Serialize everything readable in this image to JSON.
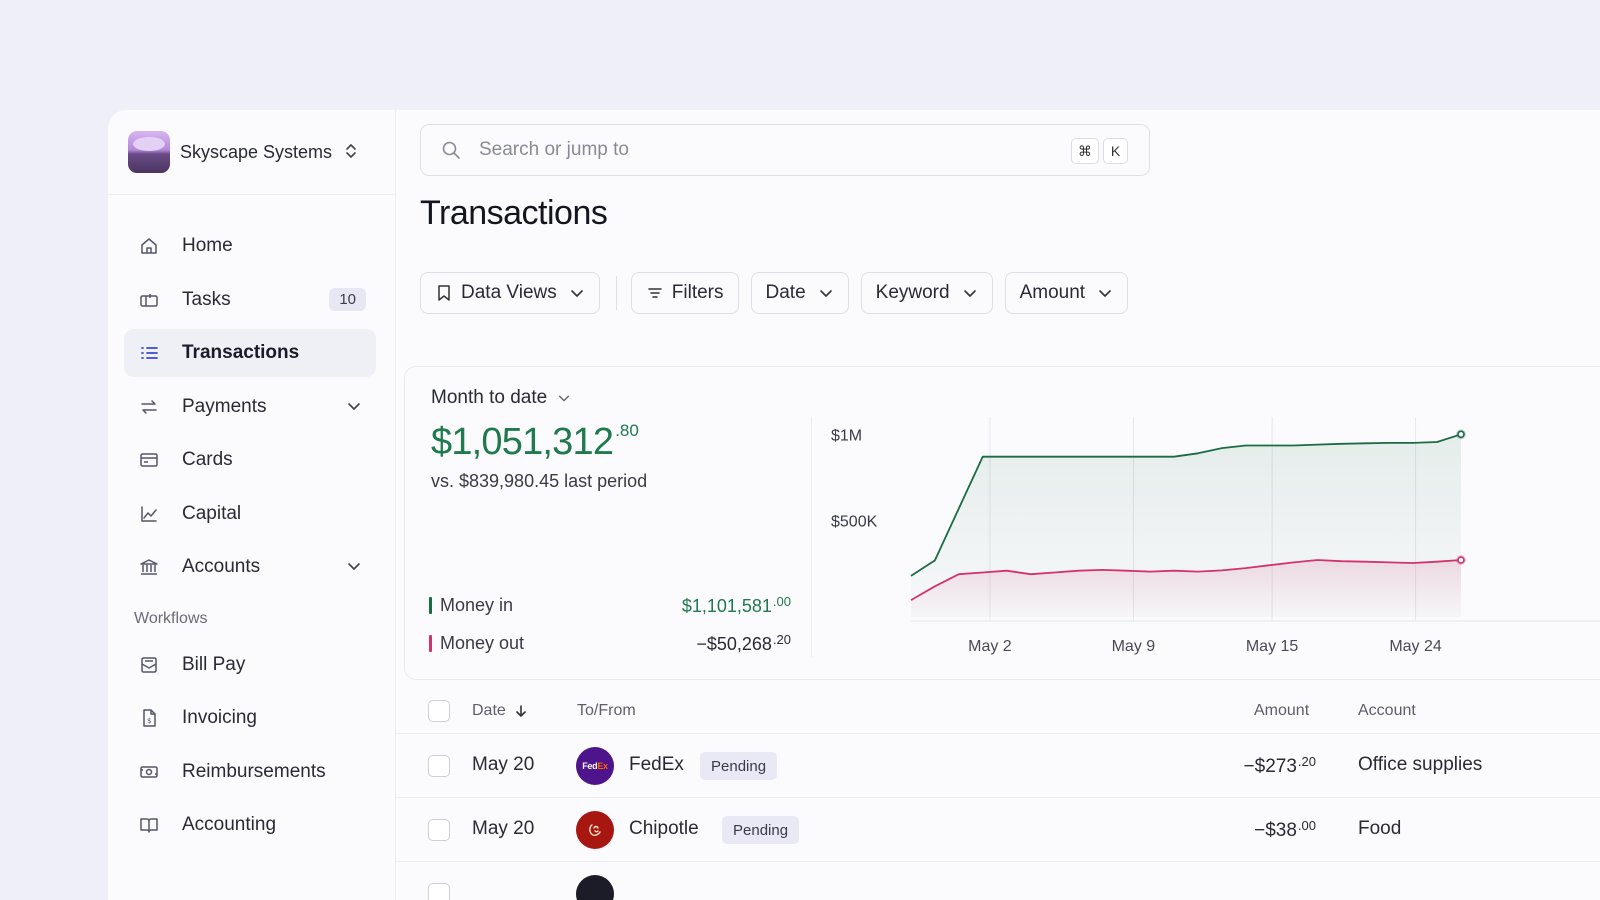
{
  "org": {
    "name": "Skyscape Systems"
  },
  "nav": {
    "items": [
      {
        "label": "Home",
        "icon": "home-icon"
      },
      {
        "label": "Tasks",
        "icon": "tasks-icon",
        "badge": "10"
      },
      {
        "label": "Transactions",
        "icon": "list-icon",
        "active": true
      },
      {
        "label": "Payments",
        "icon": "transfer-icon",
        "expandable": true
      },
      {
        "label": "Cards",
        "icon": "card-icon"
      },
      {
        "label": "Capital",
        "icon": "chart-line-icon"
      },
      {
        "label": "Accounts",
        "icon": "bank-icon",
        "expandable": true
      }
    ],
    "section_label": "Workflows",
    "workflow_items": [
      {
        "label": "Bill Pay",
        "icon": "bill-icon"
      },
      {
        "label": "Invoicing",
        "icon": "invoice-icon"
      },
      {
        "label": "Reimbursements",
        "icon": "reimbursement-icon"
      },
      {
        "label": "Accounting",
        "icon": "book-icon"
      }
    ]
  },
  "search": {
    "placeholder": "Search or jump to",
    "kbd_mod": "⌘",
    "kbd_key": "K"
  },
  "page": {
    "title": "Transactions"
  },
  "filters": {
    "data_views": "Data Views",
    "filters": "Filters",
    "date": "Date",
    "keyword": "Keyword",
    "amount": "Amount"
  },
  "summary": {
    "period": "Month to date",
    "total_main": "$1,051,312",
    "total_cents": ".80",
    "comparison": "vs. $839,980.45 last period",
    "money_in_label": "Money in",
    "money_in_main": "$1,101,581",
    "money_in_cents": ".00",
    "money_out_label": "Money out",
    "money_out_main": "−$50,268",
    "money_out_cents": ".20"
  },
  "colors": {
    "money_in": "#1b6b44",
    "money_out": "#d1336f",
    "accent": "#3e4ad0",
    "green_text": "#1f7a4d"
  },
  "chart_data": {
    "type": "line",
    "x_ticks": [
      "May 2",
      "May 9",
      "May 15",
      "May 24"
    ],
    "y_ticks": [
      "$1M",
      "$500K"
    ],
    "ylim": [
      0,
      1100000
    ],
    "x": [
      0,
      1,
      2,
      3,
      4,
      5,
      6,
      7,
      8,
      9,
      10,
      11,
      12,
      13,
      14,
      15,
      16,
      17,
      18,
      19,
      20,
      21,
      22,
      23
    ],
    "series": [
      {
        "name": "Money in",
        "values": [
          180000,
          270000,
          570000,
          870000,
          870000,
          870000,
          870000,
          870000,
          870000,
          870000,
          870000,
          870000,
          890000,
          920000,
          935000,
          935000,
          935000,
          940000,
          945000,
          948000,
          950000,
          950000,
          955000,
          1000000
        ]
      },
      {
        "name": "Money out",
        "values": [
          40000,
          120000,
          190000,
          200000,
          210000,
          190000,
          200000,
          210000,
          215000,
          210000,
          205000,
          210000,
          205000,
          212000,
          225000,
          242000,
          258000,
          272000,
          265000,
          262000,
          258000,
          255000,
          262000,
          272000
        ]
      }
    ],
    "grid": "vertical"
  },
  "table": {
    "headers": {
      "date": "Date",
      "to_from": "To/From",
      "amount": "Amount",
      "account": "Account"
    },
    "rows": [
      {
        "date": "May 20",
        "merchant": "FedEx",
        "logo_text": "FedEx",
        "logo_bg": "#4d148c",
        "status": "Pending",
        "amount_main": "−$273",
        "amount_cents": ".20",
        "account": "Office supplies"
      },
      {
        "date": "May 20",
        "merchant": "Chipotle",
        "logo_text": "C",
        "logo_bg": "#a81612",
        "status": "Pending",
        "amount_main": "−$38",
        "amount_cents": ".00",
        "account": "Food"
      }
    ]
  }
}
